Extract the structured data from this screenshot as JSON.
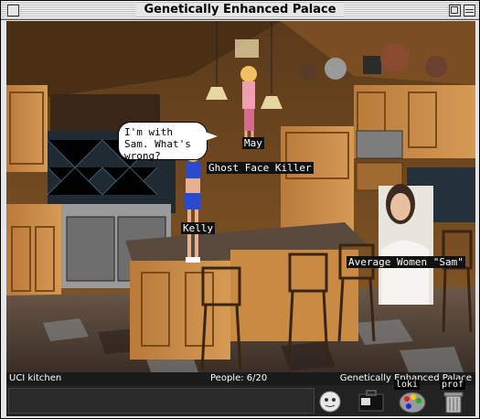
{
  "window": {
    "title": "Genetically Enhanced Palace"
  },
  "scene": {
    "avatars": [
      {
        "name": "May"
      },
      {
        "name": "Ghost Face Killer"
      },
      {
        "name": "Kelly",
        "speech": "I'm with Sam. What's wrong?"
      },
      {
        "name": "Average Women \"Sam\""
      }
    ]
  },
  "statusbar": {
    "room": "UCI kitchen",
    "people": "People: 6/20",
    "server": "Genetically Enhanced Palace"
  },
  "toolbar": {
    "icons": [
      "face-icon",
      "briefcase-icon",
      "palette-icon",
      "trash-icon"
    ],
    "labels": {
      "palette": "loki",
      "trash": "prof"
    }
  },
  "colors": {
    "status_bg": "#1a1a1a",
    "label_bg": "#111111"
  }
}
